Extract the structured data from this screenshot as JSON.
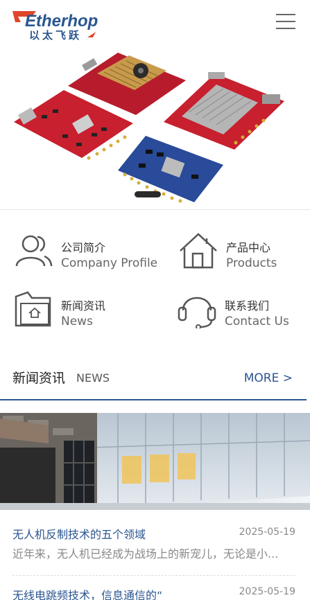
{
  "header": {
    "logo_text_en": "Etherhop",
    "logo_text_zh": "以太飞跃",
    "menu_icon": "hamburger-icon"
  },
  "banner": {
    "slides": 1,
    "active_slide": 1
  },
  "quick_links": [
    {
      "zh": "公司简介",
      "en": "Company Profile",
      "icon": "people-icon"
    },
    {
      "zh": "产品中心",
      "en": "Products",
      "icon": "house-icon"
    },
    {
      "zh": "新闻资讯",
      "en": "News",
      "icon": "folder-home-icon"
    },
    {
      "zh": "联系我们",
      "en": "Contact Us",
      "icon": "headset-icon"
    }
  ],
  "news": {
    "title": "新闻资讯",
    "title_en": "NEWS",
    "more": "MORE >",
    "items": [
      {
        "title": "无人机反制技术的五个领域",
        "date": "2025-05-19",
        "summary": "近年来，无人机已经成为战场上的新宠儿，无论是小..."
      },
      {
        "title": "无线电跳频技术，信息通信的“",
        "date": "2025-05-19"
      }
    ]
  },
  "colors": {
    "brand_blue": "#2a5590",
    "brand_red": "#e0452b",
    "text_gray": "#888888"
  }
}
